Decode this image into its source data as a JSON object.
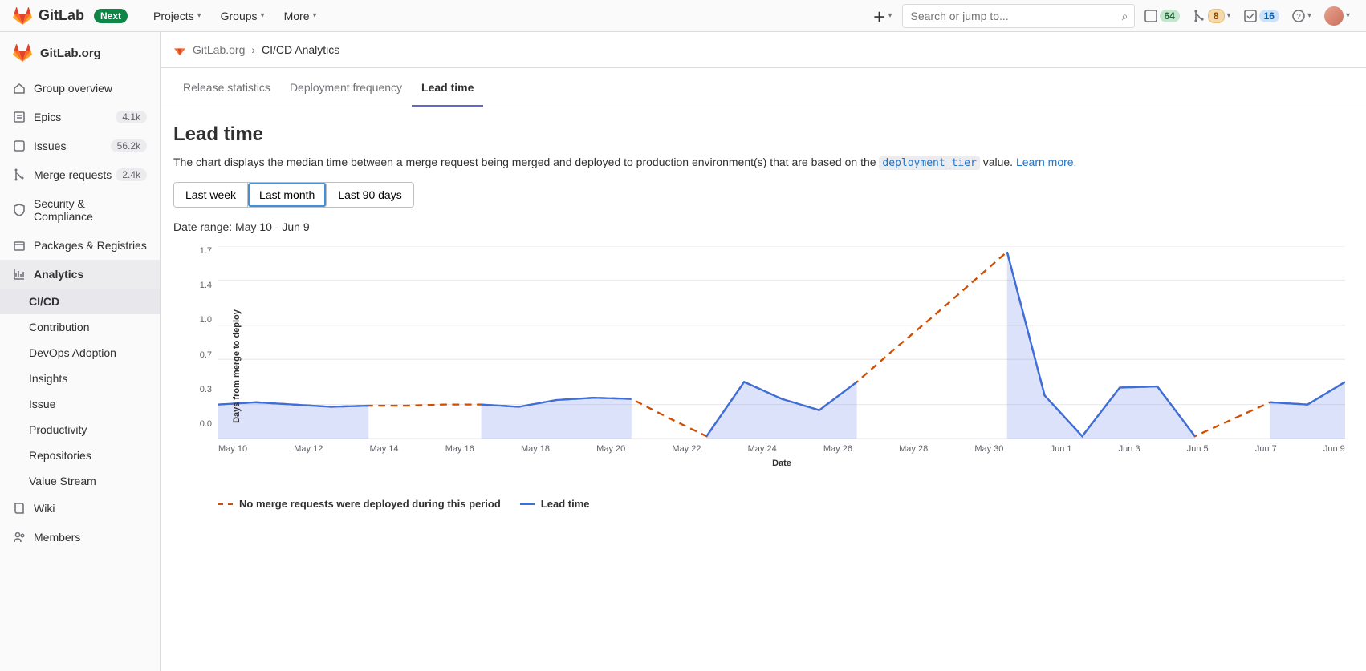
{
  "topnav": {
    "brand": "GitLab",
    "next_badge": "Next",
    "menu": [
      "Projects",
      "Groups",
      "More"
    ],
    "search_placeholder": "Search or jump to...",
    "counters": {
      "issues": "64",
      "mrs": "8",
      "todos": "16"
    }
  },
  "sidebar": {
    "project": "GitLab.org",
    "items": [
      {
        "icon": "home",
        "label": "Group overview"
      },
      {
        "icon": "epic",
        "label": "Epics",
        "count": "4.1k"
      },
      {
        "icon": "issues",
        "label": "Issues",
        "count": "56.2k"
      },
      {
        "icon": "merge",
        "label": "Merge requests",
        "count": "2.4k"
      },
      {
        "icon": "shield",
        "label": "Security & Compliance"
      },
      {
        "icon": "package",
        "label": "Packages & Registries"
      },
      {
        "icon": "chart",
        "label": "Analytics",
        "active": true
      },
      {
        "icon": "book",
        "label": "Wiki"
      },
      {
        "icon": "members",
        "label": "Members"
      }
    ],
    "analytics_sub": [
      {
        "label": "CI/CD",
        "active": true
      },
      {
        "label": "Contribution"
      },
      {
        "label": "DevOps Adoption"
      },
      {
        "label": "Insights"
      },
      {
        "label": "Issue"
      },
      {
        "label": "Productivity"
      },
      {
        "label": "Repositories"
      },
      {
        "label": "Value Stream"
      }
    ]
  },
  "breadcrumb": {
    "group": "GitLab.org",
    "page": "CI/CD Analytics"
  },
  "tabs": [
    "Release statistics",
    "Deployment frequency",
    "Lead time"
  ],
  "active_tab": "Lead time",
  "page": {
    "title": "Lead time",
    "desc_pre": "The chart displays the median time between a merge request being merged and deployed to production environment(s) that are based on the ",
    "desc_code": "deployment_tier",
    "desc_post": " value. ",
    "learn_more": "Learn more.",
    "range_buttons": [
      "Last week",
      "Last month",
      "Last 90 days"
    ],
    "active_range": "Last month",
    "date_range_label": "Date range: May 10 - Jun 9"
  },
  "chart_data": {
    "type": "line",
    "ylabel": "Days from merge to deploy",
    "xlabel": "Date",
    "ylim": [
      0.0,
      1.7
    ],
    "y_ticks": [
      "1.7",
      "1.4",
      "1.0",
      "0.7",
      "0.3",
      "0.0"
    ],
    "x_ticks": [
      "May 10",
      "May 12",
      "May 14",
      "May 16",
      "May 18",
      "May 20",
      "May 22",
      "May 24",
      "May 26",
      "May 28",
      "May 30",
      "Jun 1",
      "Jun 3",
      "Jun 5",
      "Jun 7",
      "Jun 9"
    ],
    "categories": [
      "May 10",
      "May 11",
      "May 12",
      "May 13",
      "May 14",
      "May 15",
      "May 16",
      "May 17",
      "May 18",
      "May 19",
      "May 20",
      "May 21",
      "May 22",
      "May 23",
      "May 24",
      "May 25",
      "May 26",
      "May 27",
      "May 28",
      "May 29",
      "May 30",
      "May 31",
      "Jun 1",
      "Jun 2",
      "Jun 3",
      "Jun 4",
      "Jun 5",
      "Jun 6",
      "Jun 7",
      "Jun 8",
      "Jun 9"
    ],
    "series": [
      {
        "name": "Lead time",
        "style": "solid",
        "color": "#3b6fdb",
        "values": [
          0.3,
          0.32,
          0.3,
          0.28,
          0.29,
          null,
          null,
          0.3,
          0.28,
          0.34,
          0.36,
          0.35,
          null,
          0.02,
          0.5,
          0.35,
          0.25,
          0.5,
          null,
          null,
          null,
          1.65,
          0.38,
          0.02,
          0.45,
          0.46,
          0.02,
          null,
          0.32,
          0.3,
          0.5
        ]
      },
      {
        "name": "No merge requests were deployed during this period",
        "style": "dashed",
        "color": "#d14e00",
        "values": [
          0.3,
          0.32,
          0.3,
          0.28,
          0.29,
          0.29,
          0.3,
          0.3,
          0.28,
          0.34,
          0.36,
          0.35,
          0.18,
          0.02,
          0.5,
          0.35,
          0.25,
          0.5,
          0.79,
          1.07,
          1.36,
          1.65,
          0.38,
          0.02,
          0.45,
          0.46,
          0.02,
          0.17,
          0.32,
          0.3,
          0.5
        ]
      }
    ],
    "legend": [
      {
        "swatch": "dash",
        "label": "No merge requests were deployed during this period"
      },
      {
        "swatch": "line",
        "label": "Lead time"
      }
    ]
  }
}
